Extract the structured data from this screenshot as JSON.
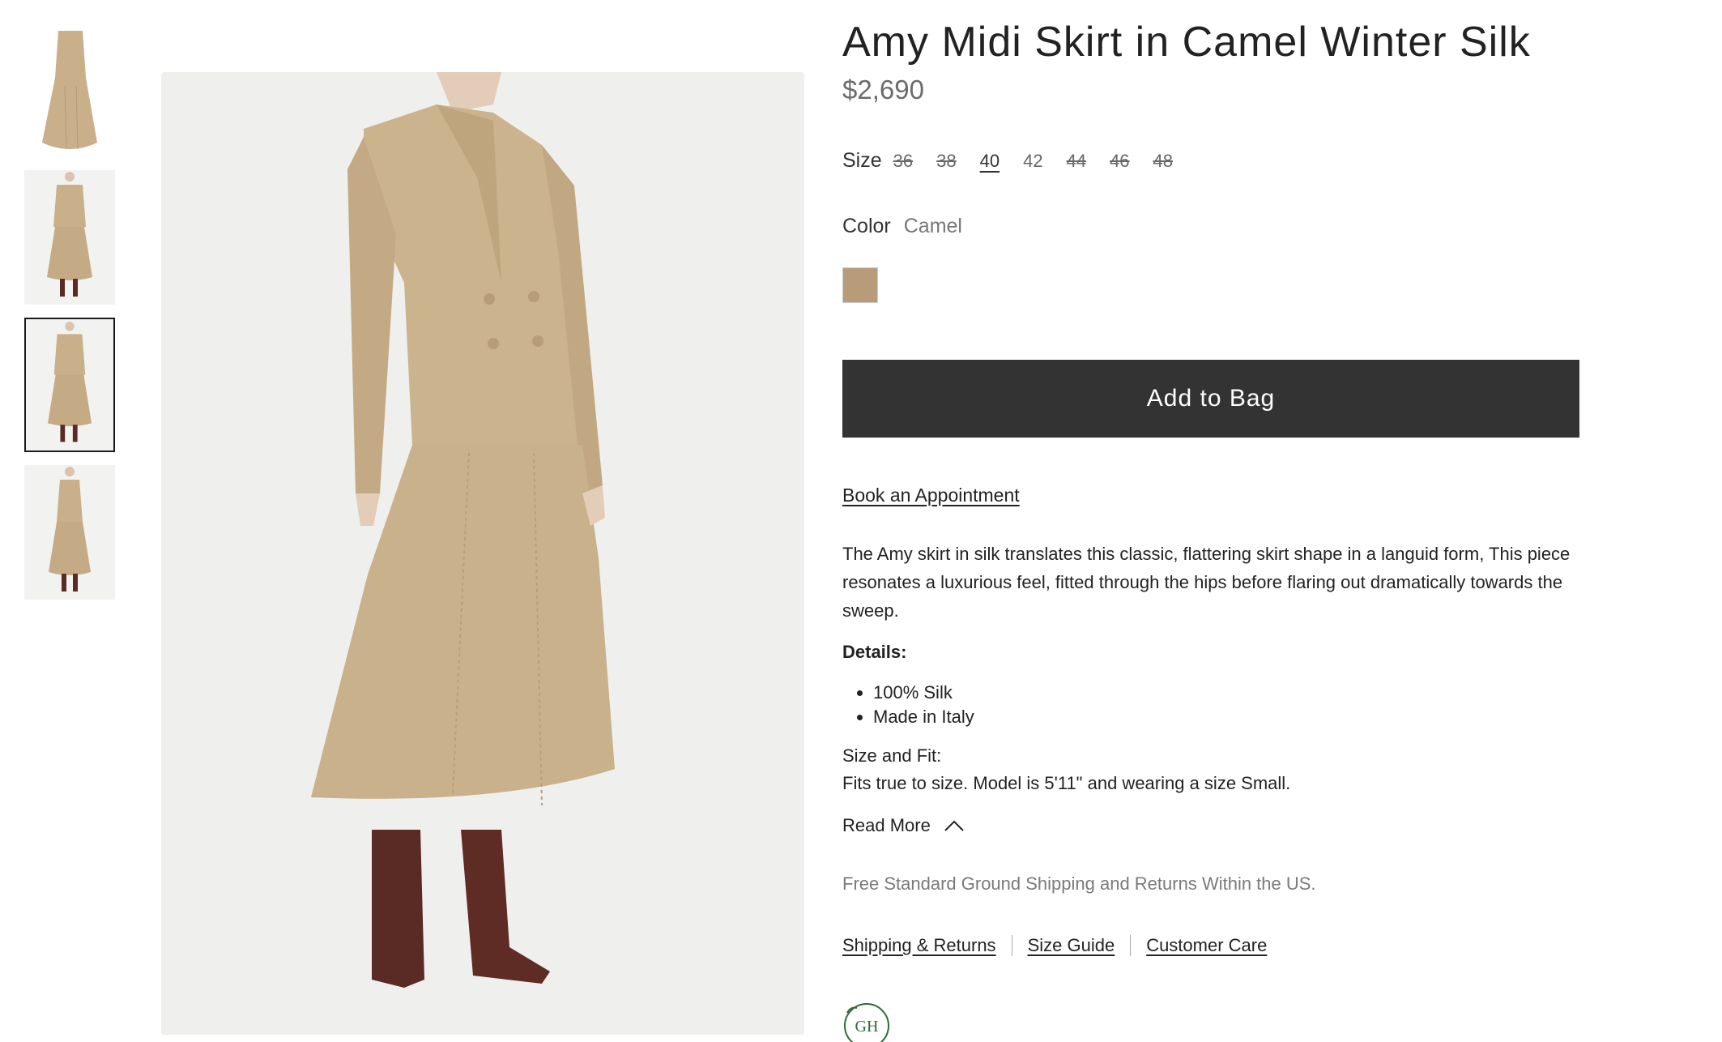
{
  "gallery": {
    "thumbnail_count": 4,
    "selected_index": 2
  },
  "product": {
    "title": "Amy Midi Skirt in Camel Winter Silk",
    "price": "$2,690",
    "size": {
      "label": "Size",
      "options": [
        {
          "value": "36",
          "available": false
        },
        {
          "value": "38",
          "available": false
        },
        {
          "value": "40",
          "available": true,
          "selected": true
        },
        {
          "value": "42",
          "available": true
        },
        {
          "value": "44",
          "available": false
        },
        {
          "value": "46",
          "available": false
        },
        {
          "value": "48",
          "available": false
        }
      ]
    },
    "color": {
      "label": "Color",
      "value": "Camel",
      "swatch_hex": "#b89b78"
    },
    "add_to_bag": "Add to Bag",
    "book_appointment": "Book an Appointment",
    "description": "The Amy skirt in silk translates this classic, flattering skirt shape in a languid form, This piece resonates a luxurious feel, fitted through the hips before flaring out dramatically towards the sweep.",
    "details_heading": "Details:",
    "details": [
      "100% Silk",
      "Made in Italy"
    ],
    "fit_heading": "Size and Fit:",
    "fit_text": "Fits true to size. Model is 5'11\" and wearing a size Small.",
    "read_more": "Read More",
    "shipping_note": "Free Standard Ground Shipping and Returns Within the US.",
    "links": {
      "shipping": "Shipping & Returns",
      "size_guide": "Size Guide",
      "customer_care": "Customer Care"
    },
    "logo_text": "GH"
  },
  "colors": {
    "button_bg": "#333333",
    "camel": "#c8b08a",
    "boot": "#5a2a24",
    "logo_green": "#2f6b3a"
  }
}
